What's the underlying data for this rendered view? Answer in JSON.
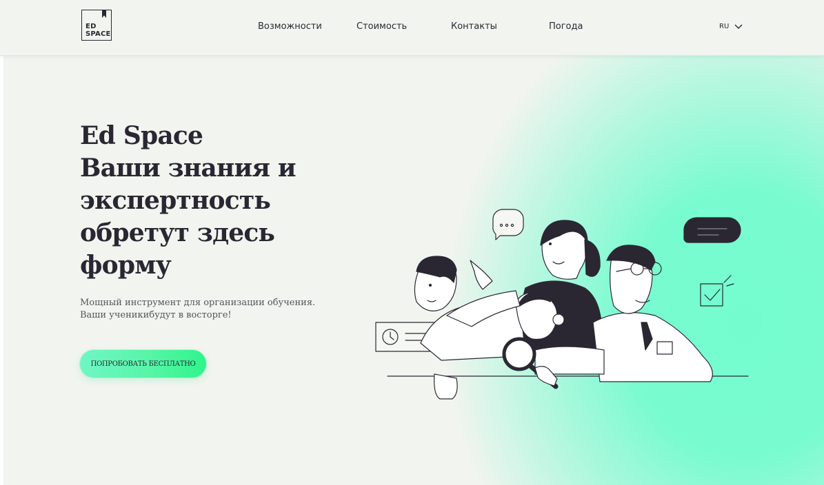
{
  "brand": {
    "logo_line1": "ED",
    "logo_line2": "SPACE"
  },
  "nav": {
    "items": [
      {
        "label": "Возможности"
      },
      {
        "label": "Стоимость"
      },
      {
        "label": "Контакты"
      },
      {
        "label": "Погода"
      }
    ],
    "language": "RU"
  },
  "hero": {
    "title_lines": [
      "Ed Space",
      "Ваши знания и",
      "экспертность",
      "обретут здесь",
      "форму"
    ],
    "subtitle_lines": [
      "Мощный инструмент для организации обучения.",
      "Ваши ученикибудут в восторге!"
    ],
    "cta_label": "ПОПРОБОВАТЬ БЕСПЛАТНО"
  },
  "colors": {
    "background": "#f2f4ef",
    "accent": "#74fccf",
    "button_gradient_end": "#2ef58a",
    "text": "#2a2733"
  },
  "icons": [
    "chevron-down-icon",
    "bookmark-icon"
  ]
}
